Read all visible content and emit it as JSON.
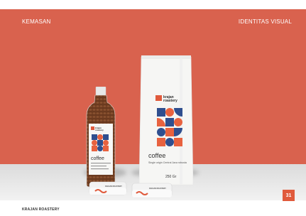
{
  "header": {
    "left_label": "KEMASAN",
    "right_label": "IDENTITAS VISUAL"
  },
  "brand": {
    "name_line1": "krajan",
    "name_line2": "roastery"
  },
  "bag": {
    "title": "coffee",
    "description": "Single origin Central Java robusta",
    "weight": "250 Gr"
  },
  "bottle": {
    "title": "coffee"
  },
  "jar": {
    "brand_text": "KRAJAN ROASTERY"
  },
  "footer": {
    "label": "KRAJAN ROASTERY",
    "page_number": "31"
  },
  "colors": {
    "hero": "#d9624e",
    "accent": "#e05a3c",
    "pattern_blue": "#2f4f8f",
    "pattern_orange": "#e8623f"
  }
}
